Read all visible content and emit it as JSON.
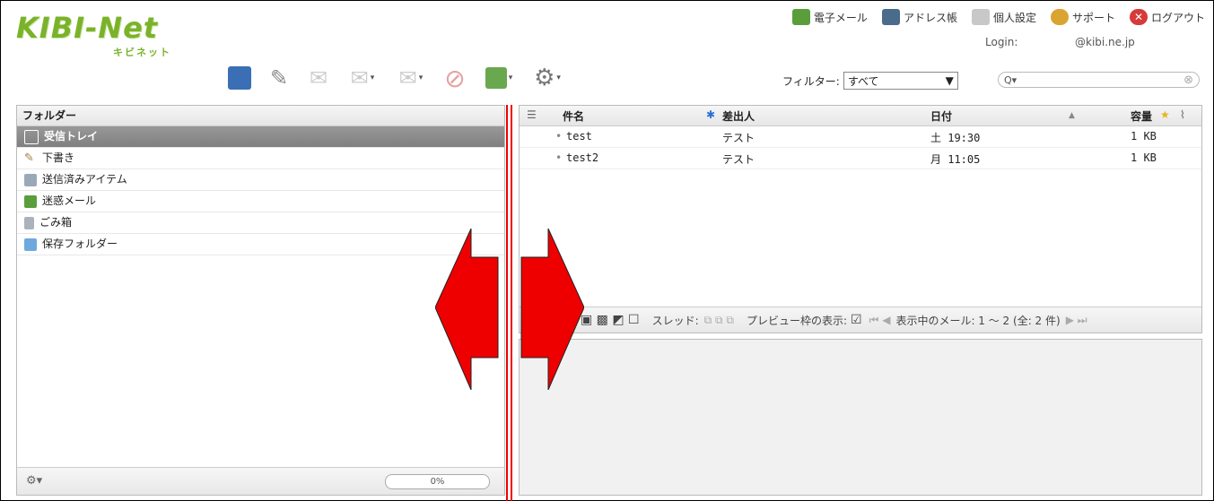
{
  "logo": {
    "main": "KIBI-Net",
    "sub": "キビネット"
  },
  "topnav": [
    {
      "label": "電子メール",
      "icon": "mail-download-icon",
      "color": "#5a9e3c"
    },
    {
      "label": "アドレス帳",
      "icon": "address-book-icon",
      "color": "#4a6b8a"
    },
    {
      "label": "個人設定",
      "icon": "settings-panel-icon",
      "color": "#8a8a8a"
    },
    {
      "label": "サポート",
      "icon": "support-person-icon",
      "color": "#d9a431"
    },
    {
      "label": "ログアウト",
      "icon": "logout-icon",
      "color": "#d63a3a"
    }
  ],
  "login": {
    "label": "Login:",
    "user": "@kibi.ne.jp"
  },
  "filter": {
    "label": "フィルター:",
    "value": "すべて"
  },
  "search": {
    "prefix": "Q▾",
    "clear": "⊗"
  },
  "folders": {
    "header": "フォルダー",
    "items": [
      {
        "label": "受信トレイ",
        "icon": "inbox-icon",
        "selected": true
      },
      {
        "label": "下書き",
        "icon": "pencil-icon"
      },
      {
        "label": "送信済みアイテム",
        "icon": "sent-icon"
      },
      {
        "label": "迷惑メール",
        "icon": "junk-icon"
      },
      {
        "label": "ごみ箱",
        "icon": "trash-icon"
      },
      {
        "label": "保存フォルダー",
        "icon": "folder-icon"
      }
    ],
    "quota": "0%"
  },
  "messages": {
    "columns": {
      "subject": "件名",
      "from": "差出人",
      "date": "日付",
      "size": "容量"
    },
    "rows": [
      {
        "subject": "test",
        "from": "テスト",
        "date": "土 19:30",
        "size": "1 KB"
      },
      {
        "subject": "test2",
        "from": "テスト",
        "date": "月 11:05",
        "size": "1 KB"
      }
    ],
    "footer": {
      "thread": "スレッド:",
      "preview": "プレビュー枠の表示:",
      "count": "表示中のメール: 1 〜 2 (全: 2 件)"
    }
  },
  "colors": {
    "accent": "#7ab32a",
    "selected": "#8a8a8a",
    "arrow": "#ee0000"
  }
}
